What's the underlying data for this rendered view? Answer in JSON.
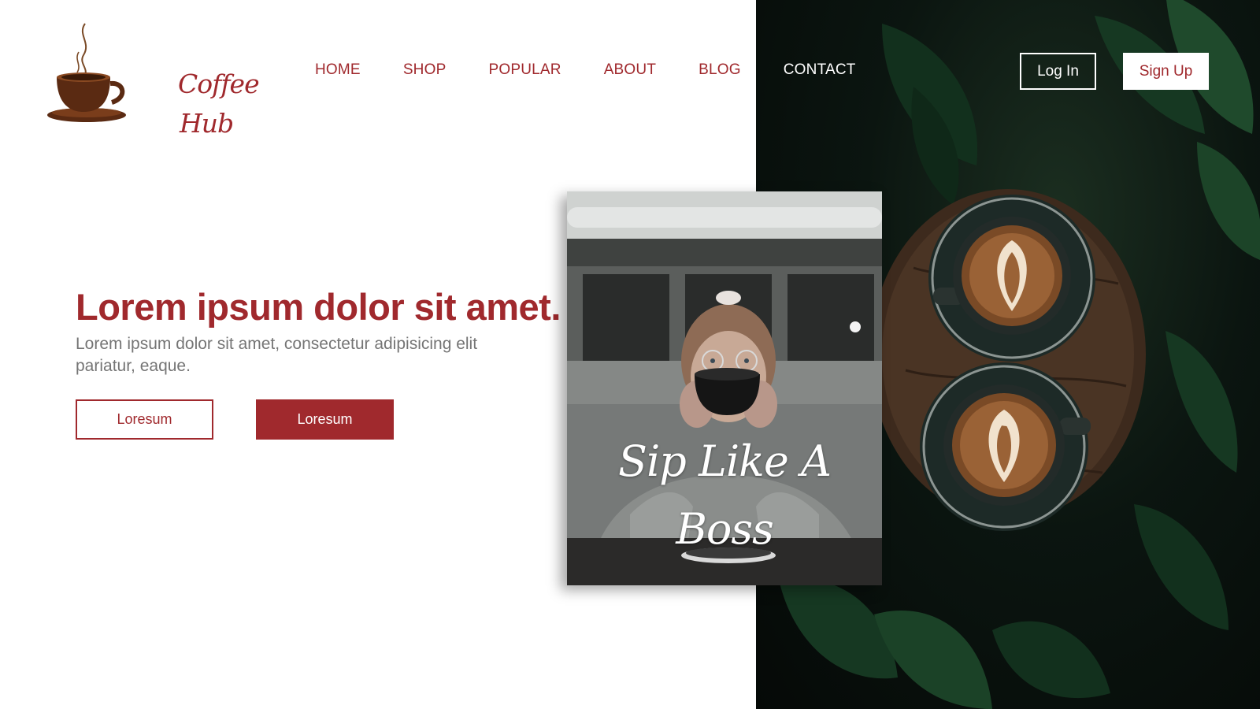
{
  "brand": {
    "name_line1": "Coffee",
    "name_line2": "Hub"
  },
  "nav": {
    "items": [
      {
        "label": "HOME",
        "active": false
      },
      {
        "label": "SHOP",
        "active": false
      },
      {
        "label": "POPULAR",
        "active": false
      },
      {
        "label": "ABOUT",
        "active": false
      },
      {
        "label": "BLOG",
        "active": false
      },
      {
        "label": "CONTACT",
        "active": true
      }
    ]
  },
  "auth": {
    "login_label": "Log In",
    "signup_label": "Sign Up"
  },
  "hero": {
    "title": "Lorem ipsum dolor sit amet.",
    "subtitle": "Lorem ipsum dolor sit amet, consectetur adipisicing elit pariatur, eaque.",
    "primary_button": "Loresum",
    "secondary_button": "Loresum"
  },
  "card": {
    "caption_line1": "Sip Like A",
    "caption_line2": "Boss"
  },
  "colors": {
    "accent": "#a0292d",
    "muted_text": "#757575",
    "dark_panel": "#0b1510"
  }
}
